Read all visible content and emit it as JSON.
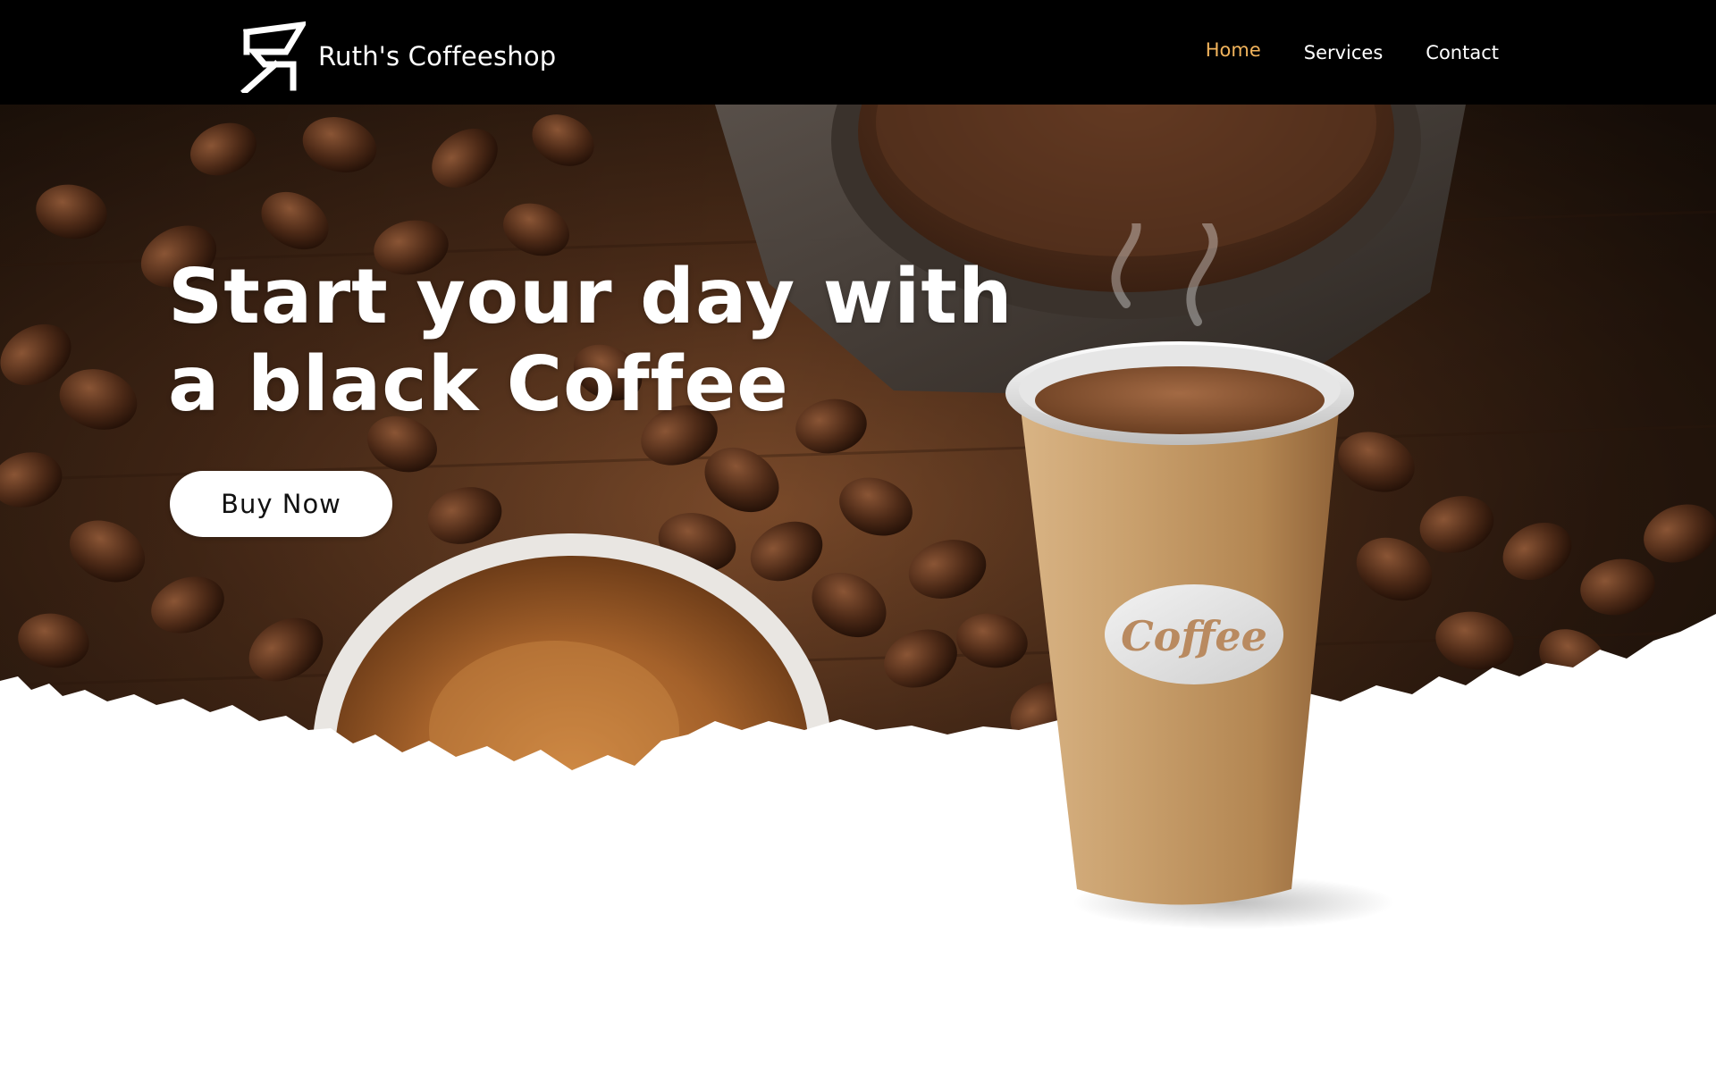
{
  "brand": {
    "logo_icon": "rs-monogram-logo",
    "name": "Ruth's Coffeeshop"
  },
  "nav": {
    "items": [
      {
        "label": "Home",
        "active": true
      },
      {
        "label": "Services",
        "active": false
      },
      {
        "label": "Contact",
        "active": false
      }
    ]
  },
  "hero": {
    "headline_line1": "Start your day with",
    "headline_line2": "a black Coffee",
    "cta_label": "Buy Now",
    "cup_label": "Coffee"
  },
  "colors": {
    "navbar_bg": "#000000",
    "nav_active": "#f2b45c",
    "nav_text": "#ffffff",
    "hero_text": "#ffffff",
    "cta_bg": "#ffffff",
    "page_bg": "#ffffff"
  }
}
